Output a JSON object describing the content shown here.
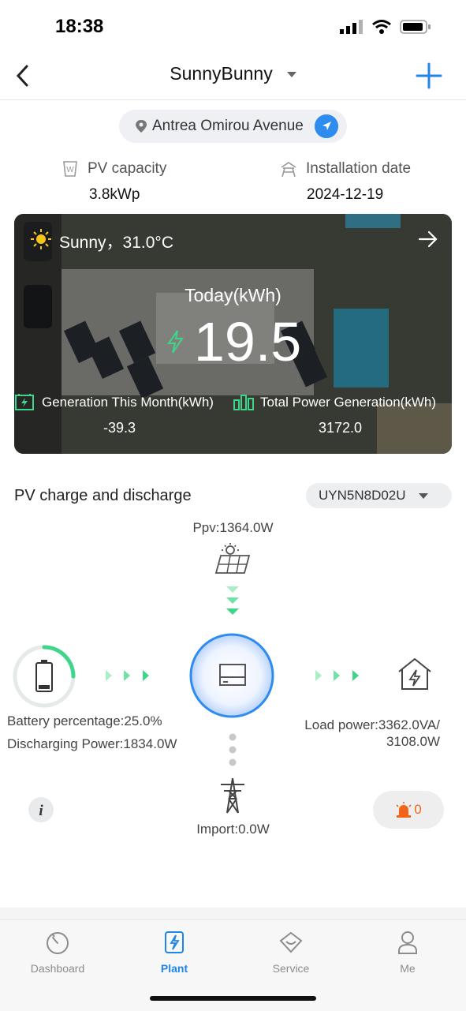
{
  "status_bar": {
    "time": "18:38"
  },
  "header": {
    "title": "SunnyBunny"
  },
  "location": {
    "text": "Antrea Omirou Avenue"
  },
  "info": {
    "pv_capacity_label": "PV capacity",
    "pv_capacity_value": "3.8kWp",
    "install_label": "Installation date",
    "install_value": "2024-12-19"
  },
  "hero": {
    "weather": "Sunny，31.0°C",
    "today_label": "Today(kWh)",
    "today_value": "19.5",
    "month_label": "Generation This Month(kWh)",
    "month_value": "-39.3",
    "total_label": "Total Power Generation(kWh)",
    "total_value": "3172.0"
  },
  "section": {
    "title": "PV charge and discharge",
    "device": "UYN5N8D02U"
  },
  "flow": {
    "ppv": "Ppv:1364.0W",
    "battery_percentage": "Battery percentage:25.0%",
    "battery_fraction": 0.25,
    "discharging": "Discharging Power:1834.0W",
    "load_line1": "Load power:3362.0VA/",
    "load_line2": "3108.0W",
    "import": "Import:0.0W",
    "alarm_count": "0"
  },
  "tabs": [
    {
      "label": "Dashboard",
      "icon": "gauge-icon"
    },
    {
      "label": "Plant",
      "icon": "plant-icon"
    },
    {
      "label": "Service",
      "icon": "service-icon"
    },
    {
      "label": "Me",
      "icon": "person-icon"
    }
  ],
  "colors": {
    "accent": "#1d86e8",
    "green": "#3ed68a",
    "alarm": "#f2641c"
  }
}
